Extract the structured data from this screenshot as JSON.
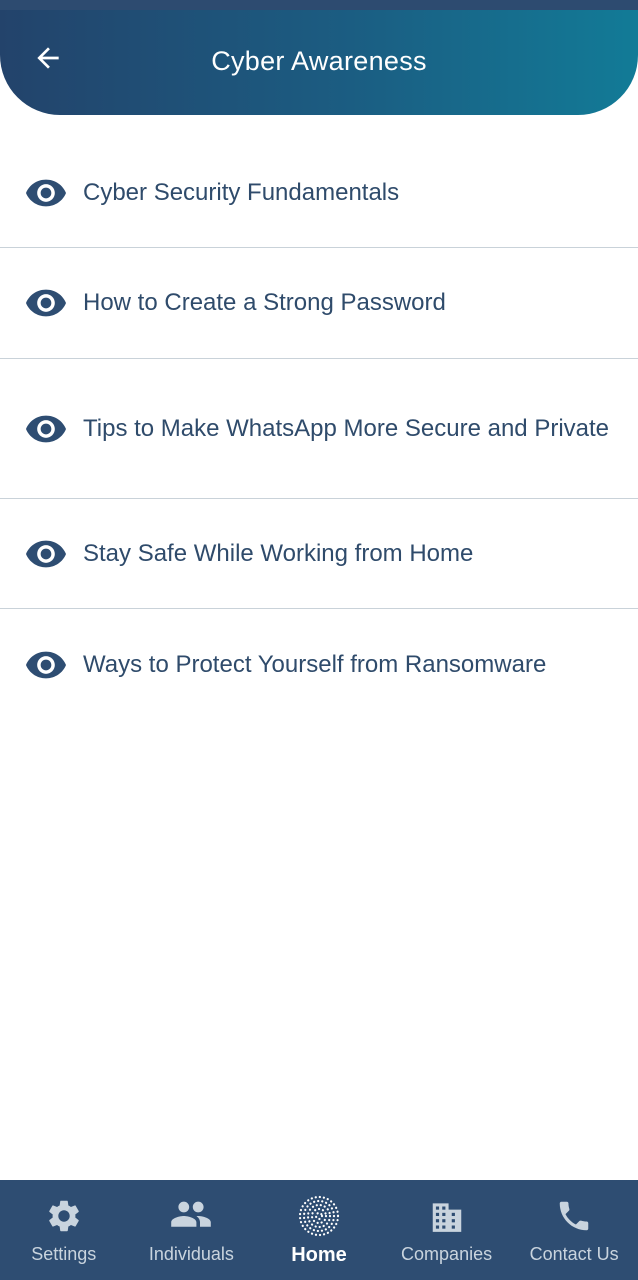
{
  "header": {
    "title": "Cyber Awareness",
    "back_icon": "arrow-left-icon"
  },
  "articles": [
    {
      "label": "Cyber Security Fundamentals",
      "icon": "eye-icon"
    },
    {
      "label": "How to Create a Strong Password",
      "icon": "eye-icon"
    },
    {
      "label": "Tips to Make WhatsApp More Secure and Private",
      "icon": "eye-icon"
    },
    {
      "label": "Stay Safe While Working from Home",
      "icon": "eye-icon"
    },
    {
      "label": "Ways to Protect Yourself from Ransomware",
      "icon": "eye-icon"
    }
  ],
  "bottom_nav": {
    "items": [
      {
        "label": "Settings",
        "icon": "gear-icon",
        "active": false
      },
      {
        "label": "Individuals",
        "icon": "people-icon",
        "active": false
      },
      {
        "label": "Home",
        "icon": "fingerprint-dots-icon",
        "active": true
      },
      {
        "label": "Companies",
        "icon": "building-icon",
        "active": false
      },
      {
        "label": "Contact Us",
        "icon": "phone-icon",
        "active": false
      }
    ]
  },
  "colors": {
    "header_gradient_start": "#23436b",
    "header_gradient_end": "#127b97",
    "text_primary": "#2f4b6b",
    "nav_background": "#2e4d72",
    "nav_inactive": "#c9d4de",
    "nav_active": "#ffffff"
  }
}
